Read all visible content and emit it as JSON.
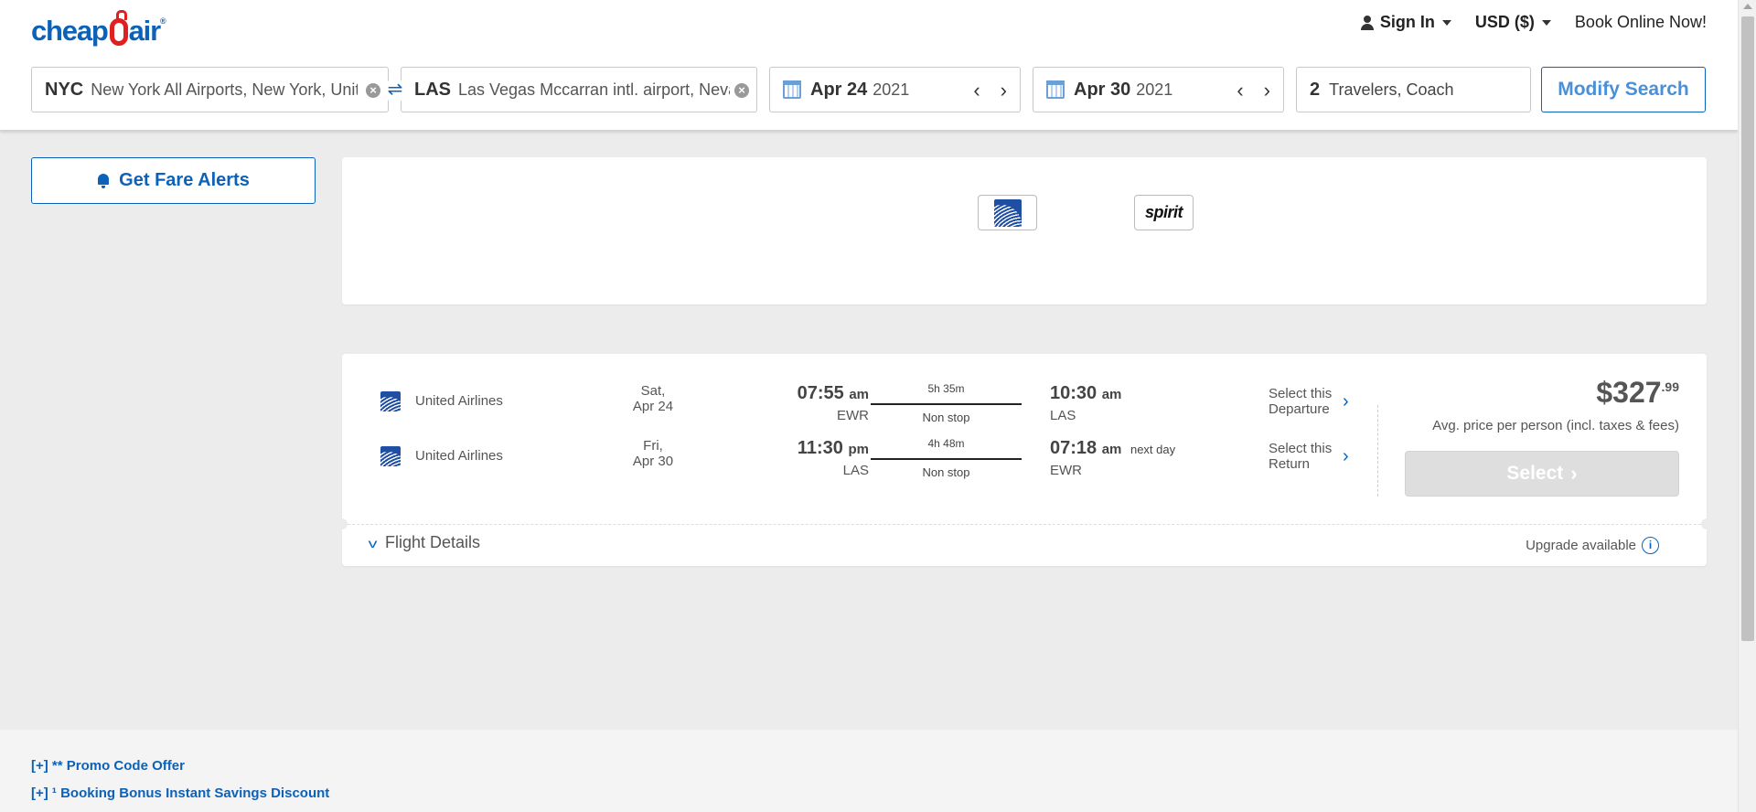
{
  "header": {
    "logo": {
      "text_before": "cheap",
      "text_after": "air",
      "reg": "®"
    },
    "sign_in": "Sign In",
    "currency": "USD ($)",
    "book_online": "Book Online Now!"
  },
  "search": {
    "origin": {
      "code": "NYC",
      "place": "New York All Airports, New York, United States"
    },
    "destination": {
      "code": "LAS",
      "place": "Las Vegas Mccarran intl. airport, Nevada, United States"
    },
    "depart": {
      "date": "Apr 24",
      "year": "2021"
    },
    "return": {
      "date": "Apr 30",
      "year": "2021"
    },
    "travelers": {
      "count": "2",
      "label": "Travelers, Coach"
    },
    "modify_label": "Modify Search"
  },
  "sidebar": {
    "fare_alerts": "Get Fare Alerts"
  },
  "airline_filter": {
    "airlines": [
      {
        "name": "United Airlines",
        "icon": "united-globe-icon"
      },
      {
        "name": "spirit",
        "icon": "spirit-logo"
      }
    ]
  },
  "result": {
    "legs": [
      {
        "airline": "United Airlines",
        "day": "Sat,",
        "date": "Apr 24",
        "dep_time": "07:55",
        "dep_ampm": "am",
        "dep_airport": "EWR",
        "duration": "5h 35m",
        "stops": "Non stop",
        "arr_time": "10:30",
        "arr_ampm": "am",
        "next_day": "",
        "arr_airport": "LAS",
        "select_line1": "Select this",
        "select_line2": "Departure"
      },
      {
        "airline": "United Airlines",
        "day": "Fri,",
        "date": "Apr 30",
        "dep_time": "11:30",
        "dep_ampm": "pm",
        "dep_airport": "LAS",
        "duration": "4h 48m",
        "stops": "Non stop",
        "arr_time": "07:18",
        "arr_ampm": "am",
        "next_day": "next day",
        "arr_airport": "EWR",
        "select_line1": "Select this",
        "select_line2": "Return"
      }
    ],
    "price_main": "$327",
    "price_cents": ".99",
    "avg_price_note": "Avg. price per person (incl. taxes & fees)",
    "select_label": "Select",
    "flight_details": "Flight Details",
    "upgrade": "Upgrade available"
  },
  "footer": {
    "links": [
      "[+] ** Promo Code Offer",
      "[+] ¹ Booking Bonus Instant Savings Discount"
    ]
  },
  "colors": {
    "brand_blue": "#0b62b8",
    "brand_red": "#e02020",
    "page_bg": "#ececec"
  }
}
